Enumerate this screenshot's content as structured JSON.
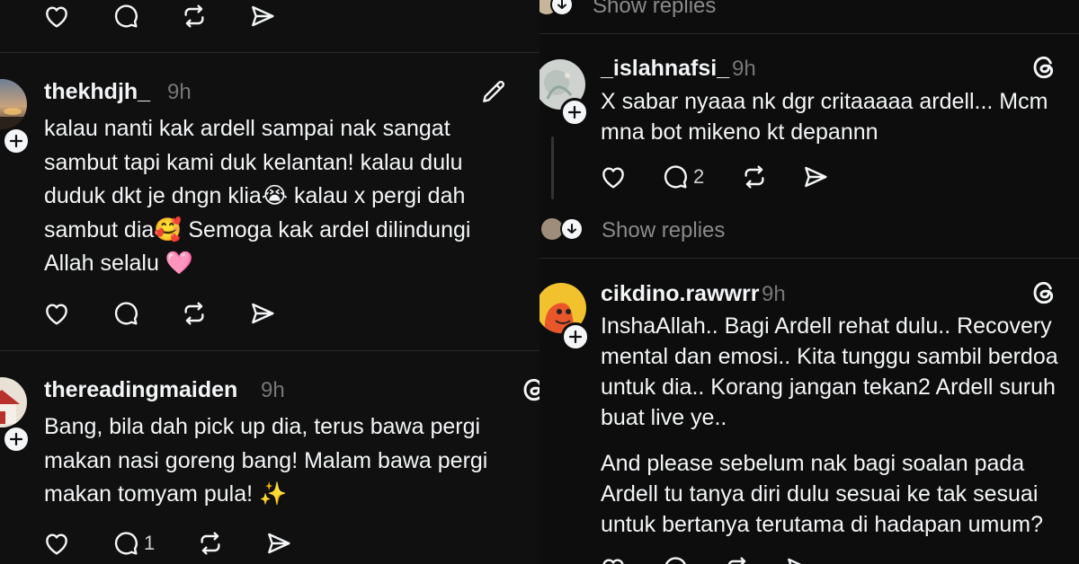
{
  "left": {
    "post1": {
      "username": "thekhdjh_",
      "time": "9h",
      "lines": [
        "kalau nanti kak ardell sampai nak sangat",
        "sambut tapi kami duk kelantan! kalau dulu",
        "duduk dkt je dngn klia😭  kalau x pergi dah",
        "sambut dia🥰 Semoga kak ardel dilindungi",
        "Allah selalu 🩷"
      ]
    },
    "post2": {
      "username": "thereadingmaiden",
      "time": "9h",
      "lines": [
        "Bang, bila dah pick up dia, terus bawa pergi",
        "makan nasi goreng bang! Malam bawa pergi",
        "makan tomyam pula! ✨"
      ],
      "reply_count": "1"
    }
  },
  "right": {
    "top_show_replies": "Show replies",
    "post1": {
      "username": "_islahnafsi_",
      "time": "9h",
      "lines": [
        "X sabar nyaaa nk dgr critaaaaa ardell... Mcm",
        "mna bot mikeno kt depannn"
      ],
      "reply_count": "2",
      "show_replies": "Show replies"
    },
    "post2": {
      "username": "cikdino.rawwrr",
      "time": "9h",
      "lines": [
        "InshaAllah.. Bagi Ardell rehat dulu.. Recovery",
        "mental dan emosi.. Kita tunggu sambil berdoa",
        "untuk dia.. Korang jangan tekan2 Ardell suruh",
        "buat live ye.."
      ],
      "lines2": [
        "And please sebelum nak bagi soalan pada",
        "Ardell tu tanya diri dulu sesuai ke tak sesuai",
        "untuk bertanya terutama di hadapan umum?"
      ]
    }
  },
  "icons": {
    "like": "heart-icon",
    "reply": "speech-bubble-icon",
    "repost": "repost-icon",
    "share": "send-icon",
    "edit": "pencil-icon",
    "threads": "threads-logo-icon",
    "follow": "plus-icon"
  }
}
